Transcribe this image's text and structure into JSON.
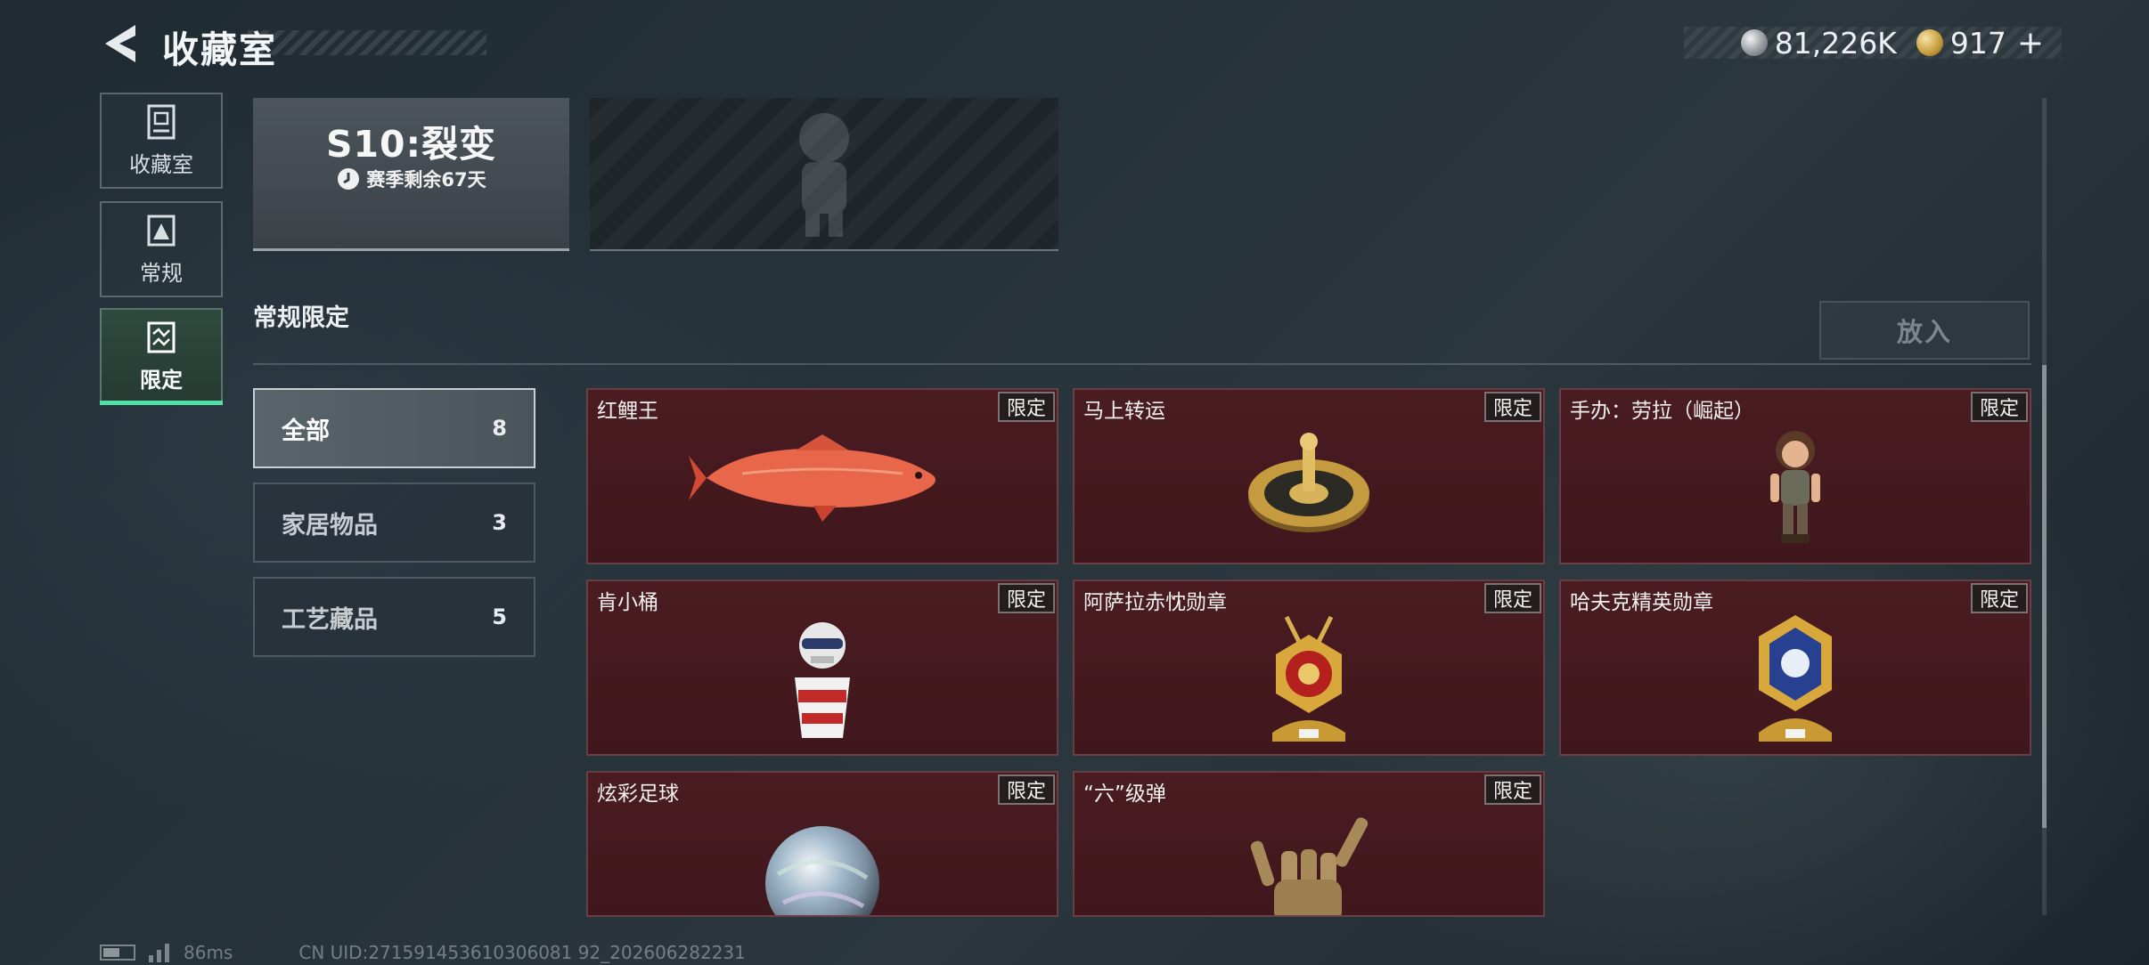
{
  "header": {
    "title": "收藏室",
    "currency": [
      {
        "icon": "silver-coin-icon",
        "value": "81,226K"
      },
      {
        "icon": "gold-coin-icon",
        "value": "917"
      }
    ],
    "currency_plus": "+"
  },
  "nav": [
    {
      "label": "收藏室",
      "icon": "collection-room-icon"
    },
    {
      "label": "常规",
      "icon": "regular-icon"
    },
    {
      "label": "限定",
      "icon": "limited-icon",
      "active": true
    }
  ],
  "season": {
    "title": "S10:裂变",
    "remaining": "赛季剩余67天"
  },
  "section": {
    "title": "常规限定",
    "place_button": "放入"
  },
  "categories": [
    {
      "label": "全部",
      "count": "8",
      "selected": true
    },
    {
      "label": "家居物品",
      "count": "3"
    },
    {
      "label": "工艺藏品",
      "count": "5"
    }
  ],
  "items": [
    {
      "name": "红鲤王",
      "badge": "限定",
      "icon": "red-carp-icon"
    },
    {
      "name": "马上转运",
      "badge": "限定",
      "icon": "lucky-wheel-icon"
    },
    {
      "name": "手办：劳拉（崛起）",
      "badge": "限定",
      "icon": "lara-figure-icon"
    },
    {
      "name": "肯小桶",
      "badge": "限定",
      "icon": "bucket-figure-icon"
    },
    {
      "name": "阿萨拉赤忱勋章",
      "badge": "限定",
      "icon": "red-medal-icon"
    },
    {
      "name": "哈夫克精英勋章",
      "badge": "限定",
      "icon": "blue-medal-icon"
    },
    {
      "name": "炫彩足球",
      "badge": "限定",
      "icon": "iridescent-ball-icon"
    },
    {
      "name": "“六”级弹",
      "badge": "限定",
      "icon": "golden-hand-icon"
    }
  ],
  "status": {
    "ping": "86ms",
    "uid": "CN UID:271591453610306081 92_202606282231"
  },
  "colors": {
    "accent": "#4fe0a4",
    "item_background": "#4a1c22"
  }
}
